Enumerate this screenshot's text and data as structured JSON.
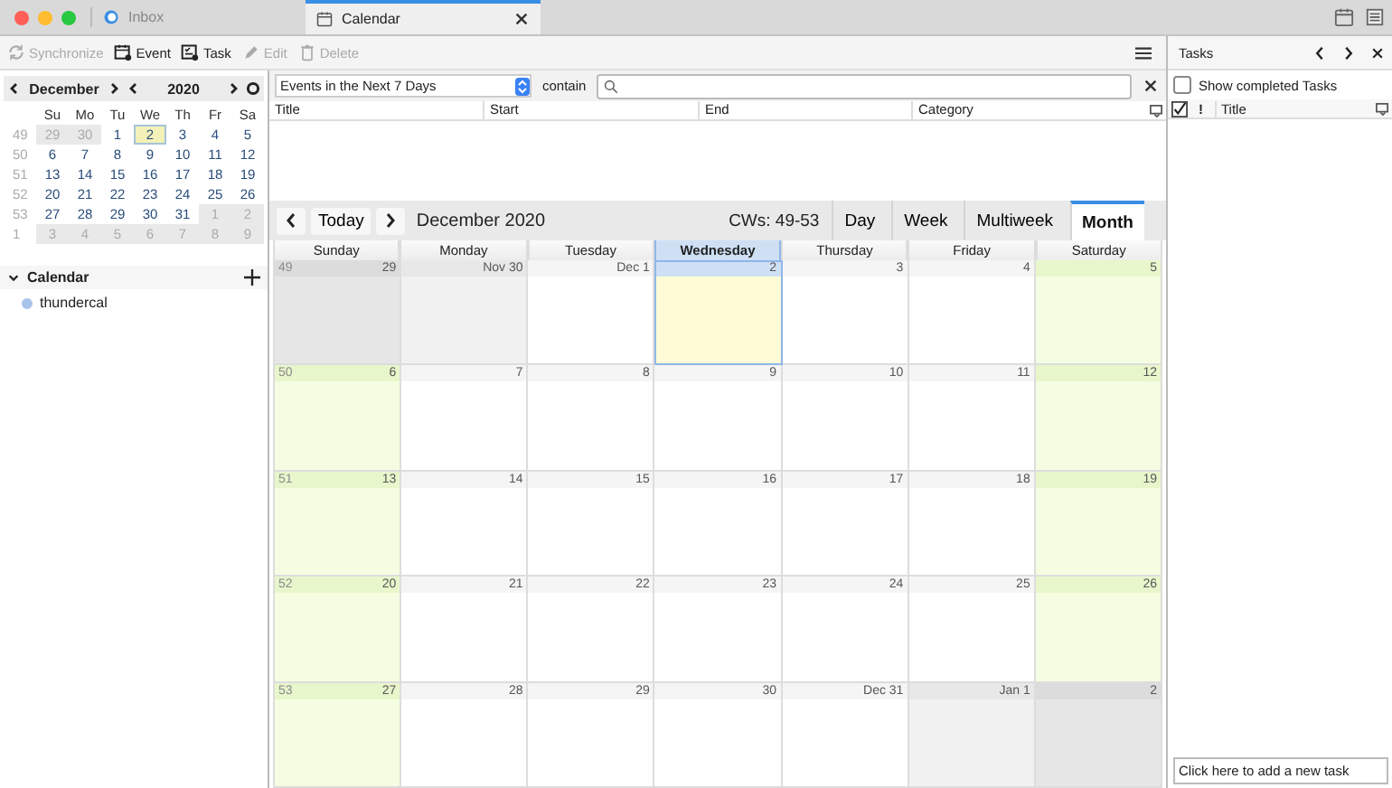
{
  "tabs": [
    {
      "label": "Inbox",
      "kind": "mail",
      "selected": false
    },
    {
      "label": "Calendar",
      "kind": "calendar",
      "selected": true
    }
  ],
  "toolbar": [
    {
      "label": "Synchronize",
      "kind": "sync",
      "disabled": true
    },
    {
      "label": "Event",
      "kind": "event",
      "disabled": false
    },
    {
      "label": "Task",
      "kind": "task",
      "disabled": false
    },
    {
      "label": "Edit",
      "kind": "edit",
      "disabled": true
    },
    {
      "label": "Delete",
      "kind": "delete",
      "disabled": true
    }
  ],
  "minimonth": {
    "month": "December",
    "year": "2020",
    "weekdays": [
      "Su",
      "Mo",
      "Tu",
      "We",
      "Th",
      "Fr",
      "Sa"
    ],
    "weeks": [
      {
        "number": "49",
        "days": [
          {
            "label": "29",
            "outside": true,
            "selected": false
          },
          {
            "label": "30",
            "outside": true,
            "selected": false
          },
          {
            "label": "1",
            "outside": false,
            "selected": false
          },
          {
            "label": "2",
            "outside": false,
            "selected": true
          },
          {
            "label": "3",
            "outside": false,
            "selected": false
          },
          {
            "label": "4",
            "outside": false,
            "selected": false
          },
          {
            "label": "5",
            "outside": false,
            "selected": false
          }
        ]
      },
      {
        "number": "50",
        "days": [
          {
            "label": "6",
            "outside": false,
            "selected": false
          },
          {
            "label": "7",
            "outside": false,
            "selected": false
          },
          {
            "label": "8",
            "outside": false,
            "selected": false
          },
          {
            "label": "9",
            "outside": false,
            "selected": false
          },
          {
            "label": "10",
            "outside": false,
            "selected": false
          },
          {
            "label": "11",
            "outside": false,
            "selected": false
          },
          {
            "label": "12",
            "outside": false,
            "selected": false
          }
        ]
      },
      {
        "number": "51",
        "days": [
          {
            "label": "13",
            "outside": false,
            "selected": false
          },
          {
            "label": "14",
            "outside": false,
            "selected": false
          },
          {
            "label": "15",
            "outside": false,
            "selected": false
          },
          {
            "label": "16",
            "outside": false,
            "selected": false
          },
          {
            "label": "17",
            "outside": false,
            "selected": false
          },
          {
            "label": "18",
            "outside": false,
            "selected": false
          },
          {
            "label": "19",
            "outside": false,
            "selected": false
          }
        ]
      },
      {
        "number": "52",
        "days": [
          {
            "label": "20",
            "outside": false,
            "selected": false
          },
          {
            "label": "21",
            "outside": false,
            "selected": false
          },
          {
            "label": "22",
            "outside": false,
            "selected": false
          },
          {
            "label": "23",
            "outside": false,
            "selected": false
          },
          {
            "label": "24",
            "outside": false,
            "selected": false
          },
          {
            "label": "25",
            "outside": false,
            "selected": false
          },
          {
            "label": "26",
            "outside": false,
            "selected": false
          }
        ]
      },
      {
        "number": "53",
        "days": [
          {
            "label": "27",
            "outside": false,
            "selected": false
          },
          {
            "label": "28",
            "outside": false,
            "selected": false
          },
          {
            "label": "29",
            "outside": false,
            "selected": false
          },
          {
            "label": "30",
            "outside": false,
            "selected": false
          },
          {
            "label": "31",
            "outside": false,
            "selected": false
          },
          {
            "label": "1",
            "outside": true,
            "selected": false
          },
          {
            "label": "2",
            "outside": true,
            "selected": false
          }
        ]
      },
      {
        "number": "1",
        "days": [
          {
            "label": "3",
            "outside": true,
            "selected": false
          },
          {
            "label": "4",
            "outside": true,
            "selected": false
          },
          {
            "label": "5",
            "outside": true,
            "selected": false
          },
          {
            "label": "6",
            "outside": true,
            "selected": false
          },
          {
            "label": "7",
            "outside": true,
            "selected": false
          },
          {
            "label": "8",
            "outside": true,
            "selected": false
          },
          {
            "label": "9",
            "outside": true,
            "selected": false
          }
        ]
      }
    ]
  },
  "calendars": {
    "title": "Calendar",
    "expanded": true,
    "items": [
      {
        "name": "thundercal",
        "color": "#a9c4ec"
      }
    ]
  },
  "event_list": {
    "filter": "Events in the Next 7 Days",
    "contain_label": "contain",
    "columns": [
      "Title",
      "Start",
      "End",
      "Category"
    ]
  },
  "calendar_view": {
    "today_button": "Today",
    "period": "December 2020",
    "weeks_label": "CWs: 49-53",
    "views": [
      {
        "label": "Day",
        "selected": false
      },
      {
        "label": "Week",
        "selected": false
      },
      {
        "label": "Multiweek",
        "selected": false
      },
      {
        "label": "Month",
        "selected": true
      }
    ],
    "weekdays": [
      {
        "label": "Sunday",
        "selected": false
      },
      {
        "label": "Monday",
        "selected": false
      },
      {
        "label": "Tuesday",
        "selected": false
      },
      {
        "label": "Wednesday",
        "selected": true
      },
      {
        "label": "Thursday",
        "selected": false
      },
      {
        "label": "Friday",
        "selected": false
      },
      {
        "label": "Saturday",
        "selected": false
      }
    ],
    "weeks": [
      {
        "number": "49",
        "days": [
          {
            "label": "29",
            "kind": "outside_weekend"
          },
          {
            "label": "Nov 30",
            "kind": "outside"
          },
          {
            "label": "Dec 1",
            "kind": "weekday"
          },
          {
            "label": "2",
            "kind": "today"
          },
          {
            "label": "3",
            "kind": "weekday"
          },
          {
            "label": "4",
            "kind": "weekday"
          },
          {
            "label": "5",
            "kind": "weekend"
          }
        ]
      },
      {
        "number": "50",
        "days": [
          {
            "label": "6",
            "kind": "weekend"
          },
          {
            "label": "7",
            "kind": "weekday"
          },
          {
            "label": "8",
            "kind": "weekday"
          },
          {
            "label": "9",
            "kind": "weekday"
          },
          {
            "label": "10",
            "kind": "weekday"
          },
          {
            "label": "11",
            "kind": "weekday"
          },
          {
            "label": "12",
            "kind": "weekend"
          }
        ]
      },
      {
        "number": "51",
        "days": [
          {
            "label": "13",
            "kind": "weekend"
          },
          {
            "label": "14",
            "kind": "weekday"
          },
          {
            "label": "15",
            "kind": "weekday"
          },
          {
            "label": "16",
            "kind": "weekday"
          },
          {
            "label": "17",
            "kind": "weekday"
          },
          {
            "label": "18",
            "kind": "weekday"
          },
          {
            "label": "19",
            "kind": "weekend"
          }
        ]
      },
      {
        "number": "52",
        "days": [
          {
            "label": "20",
            "kind": "weekend"
          },
          {
            "label": "21",
            "kind": "weekday"
          },
          {
            "label": "22",
            "kind": "weekday"
          },
          {
            "label": "23",
            "kind": "weekday"
          },
          {
            "label": "24",
            "kind": "weekday"
          },
          {
            "label": "25",
            "kind": "weekday"
          },
          {
            "label": "26",
            "kind": "weekend"
          }
        ]
      },
      {
        "number": "53",
        "days": [
          {
            "label": "27",
            "kind": "weekend"
          },
          {
            "label": "28",
            "kind": "weekday"
          },
          {
            "label": "29",
            "kind": "weekday"
          },
          {
            "label": "30",
            "kind": "weekday"
          },
          {
            "label": "Dec 31",
            "kind": "weekday"
          },
          {
            "label": "Jan 1",
            "kind": "outside"
          },
          {
            "label": "2",
            "kind": "outside_weekend"
          }
        ]
      }
    ]
  },
  "tasks": {
    "title": "Tasks",
    "show_completed": {
      "label": "Show completed Tasks",
      "checked": false
    },
    "priority_column": "!",
    "title_column": "Title",
    "new_task_placeholder": "Click here to add a new task"
  }
}
